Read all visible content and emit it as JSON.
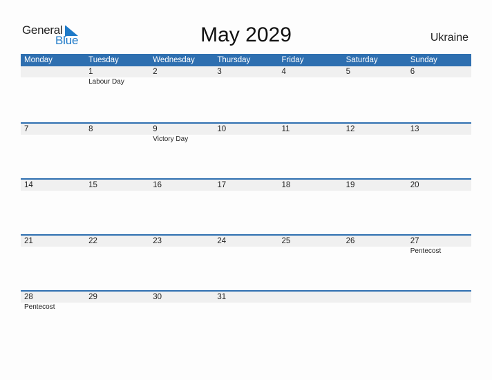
{
  "logo": {
    "general": "General",
    "blue": "Blue",
    "icon": "triangle-flag-icon"
  },
  "title": "May 2029",
  "country": "Ukraine",
  "colors": {
    "header": "#2e6fb0",
    "strip": "#f0f0f0",
    "brand_blue": "#1f7ac8"
  },
  "weekdays": [
    "Monday",
    "Tuesday",
    "Wednesday",
    "Thursday",
    "Friday",
    "Saturday",
    "Sunday"
  ],
  "weeks": [
    {
      "days": [
        "",
        "1",
        "2",
        "3",
        "4",
        "5",
        "6"
      ],
      "holidays": [
        "",
        "Labour Day",
        "",
        "",
        "",
        "",
        ""
      ]
    },
    {
      "days": [
        "7",
        "8",
        "9",
        "10",
        "11",
        "12",
        "13"
      ],
      "holidays": [
        "",
        "",
        "Victory Day",
        "",
        "",
        "",
        ""
      ]
    },
    {
      "days": [
        "14",
        "15",
        "16",
        "17",
        "18",
        "19",
        "20"
      ],
      "holidays": [
        "",
        "",
        "",
        "",
        "",
        "",
        ""
      ]
    },
    {
      "days": [
        "21",
        "22",
        "23",
        "24",
        "25",
        "26",
        "27"
      ],
      "holidays": [
        "",
        "",
        "",
        "",
        "",
        "",
        "Pentecost"
      ]
    },
    {
      "days": [
        "28",
        "29",
        "30",
        "31",
        "",
        "",
        ""
      ],
      "holidays": [
        "Pentecost",
        "",
        "",
        "",
        "",
        "",
        ""
      ]
    }
  ]
}
